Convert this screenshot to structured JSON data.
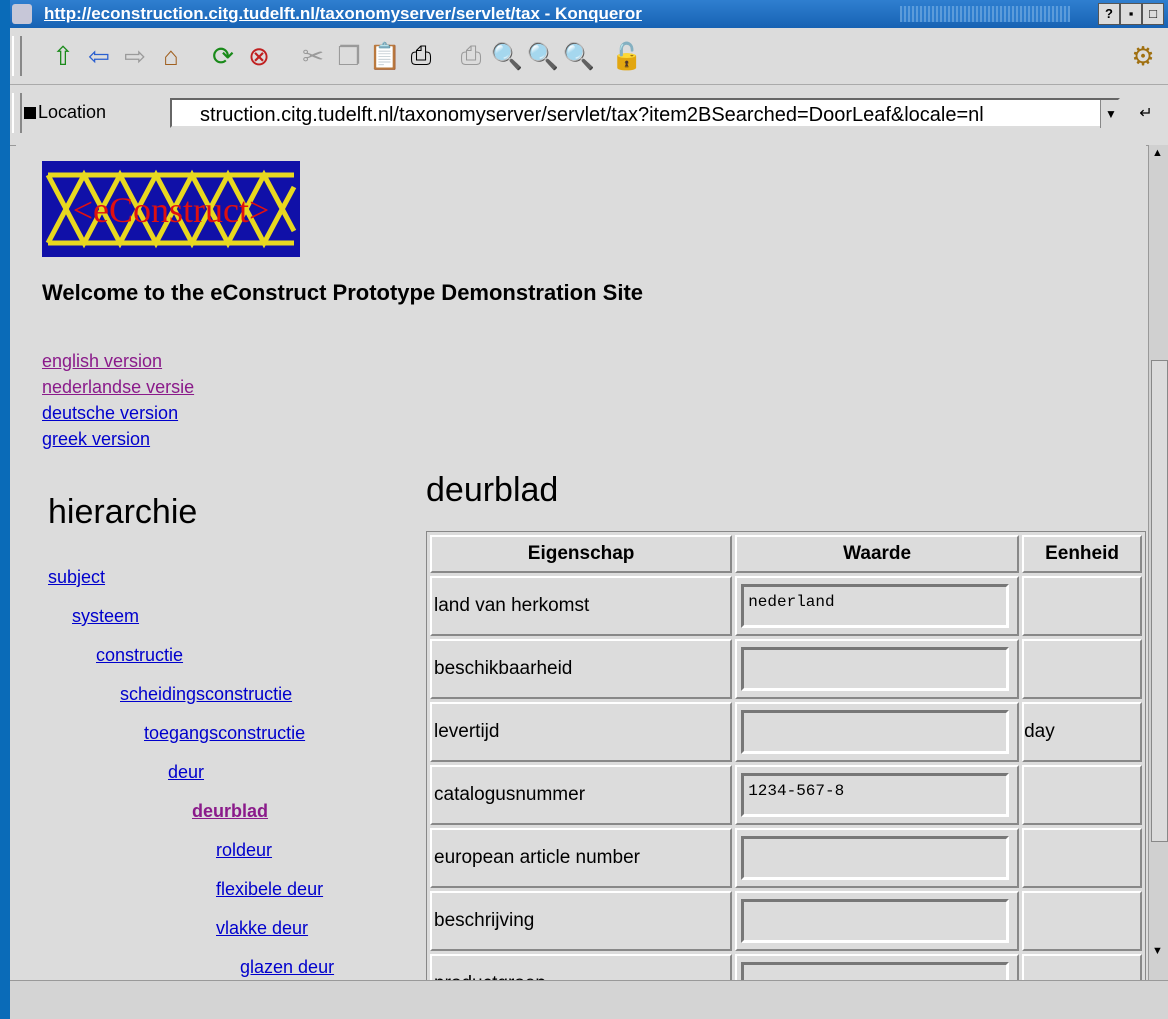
{
  "window": {
    "title": "http://econstruction.citg.tudelft.nl/taxonomyserver/servlet/tax - Konqueror",
    "buttons": [
      "?",
      "▪",
      "□"
    ]
  },
  "toolbar": {
    "icons": [
      "up-arrow-icon",
      "back-arrow-icon",
      "forward-arrow-icon",
      "home-icon",
      "reload-icon",
      "stop-icon",
      "cut-icon",
      "copy-icon",
      "paste-icon",
      "print-icon",
      "print-frame-icon",
      "find-icon",
      "zoom-in-icon",
      "zoom-out-icon",
      "lock-icon"
    ]
  },
  "location": {
    "label": "Location",
    "url": "struction.citg.tudelft.nl/taxonomyserver/servlet/tax?item2BSearched=DoorLeaf&locale=nl"
  },
  "page": {
    "welcome": "Welcome to the eConstruct Prototype Demonstration Site",
    "logo_text": "<eConstruct>",
    "languages": [
      "english version",
      "nederlandse versie",
      "deutsche version",
      "greek version"
    ],
    "hierarchy_title": "hierarchie",
    "tree": [
      "subject",
      "systeem",
      "constructie",
      "scheidingsconstructie",
      "toegangsconstructie",
      "deur",
      "deurblad",
      "roldeur",
      "flexibele deur",
      "vlakke deur",
      "glazen deur"
    ],
    "product_title": "deurblad",
    "table": {
      "headers": [
        "Eigenschap",
        "Waarde",
        "Eenheid"
      ],
      "rows": [
        {
          "property": "land van herkomst",
          "value": "nederland",
          "unit": ""
        },
        {
          "property": "beschikbaarheid",
          "value": "",
          "unit": ""
        },
        {
          "property": "levertijd",
          "value": "",
          "unit": "day"
        },
        {
          "property": "catalogusnummer",
          "value": "1234-567-8",
          "unit": ""
        },
        {
          "property": "european article number",
          "value": "",
          "unit": ""
        },
        {
          "property": "beschrijving",
          "value": "",
          "unit": ""
        },
        {
          "property": "productgroep",
          "value": "",
          "unit": ""
        }
      ]
    }
  }
}
